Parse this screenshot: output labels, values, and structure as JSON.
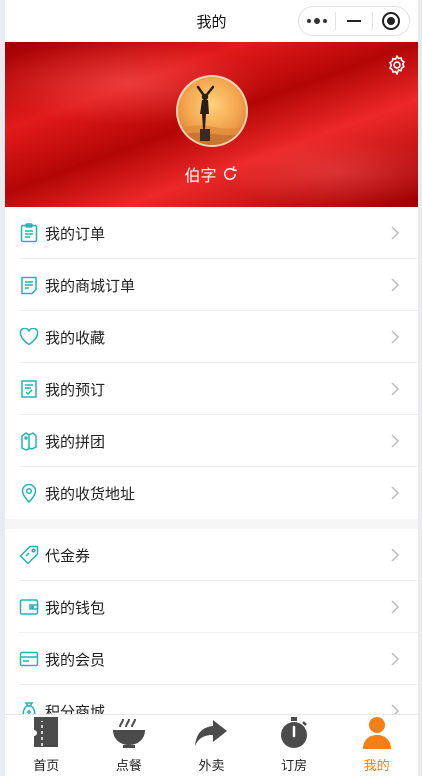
{
  "titlebar": {
    "title": "我的"
  },
  "profile": {
    "username": "伯字"
  },
  "menu_group1": [
    {
      "label": "我的订单",
      "icon": "clipboard-icon"
    },
    {
      "label": "我的商城订单",
      "icon": "order-doc-icon"
    },
    {
      "label": "我的收藏",
      "icon": "heart-icon"
    },
    {
      "label": "我的预订",
      "icon": "reservation-icon"
    },
    {
      "label": "我的拼团",
      "icon": "group-tag-icon"
    },
    {
      "label": "我的收货地址",
      "icon": "location-pin-icon"
    }
  ],
  "menu_group2": [
    {
      "label": "代金券",
      "icon": "coupon-tag-icon"
    },
    {
      "label": "我的钱包",
      "icon": "wallet-icon"
    },
    {
      "label": "我的会员",
      "icon": "member-card-icon"
    },
    {
      "label": "积分商城",
      "icon": "points-bag-icon"
    }
  ],
  "tabbar": [
    {
      "label": "首页",
      "icon": "home-ticket-icon",
      "active": false
    },
    {
      "label": "点餐",
      "icon": "noodle-bowl-icon",
      "active": false
    },
    {
      "label": "外卖",
      "icon": "share-arrow-icon",
      "active": false
    },
    {
      "label": "订房",
      "icon": "stopwatch-icon",
      "active": false
    },
    {
      "label": "我的",
      "icon": "person-icon",
      "active": true
    }
  ],
  "colors": {
    "accent": "#1fb5b5",
    "active_tab": "#f57f17",
    "banner": "#d61414"
  }
}
